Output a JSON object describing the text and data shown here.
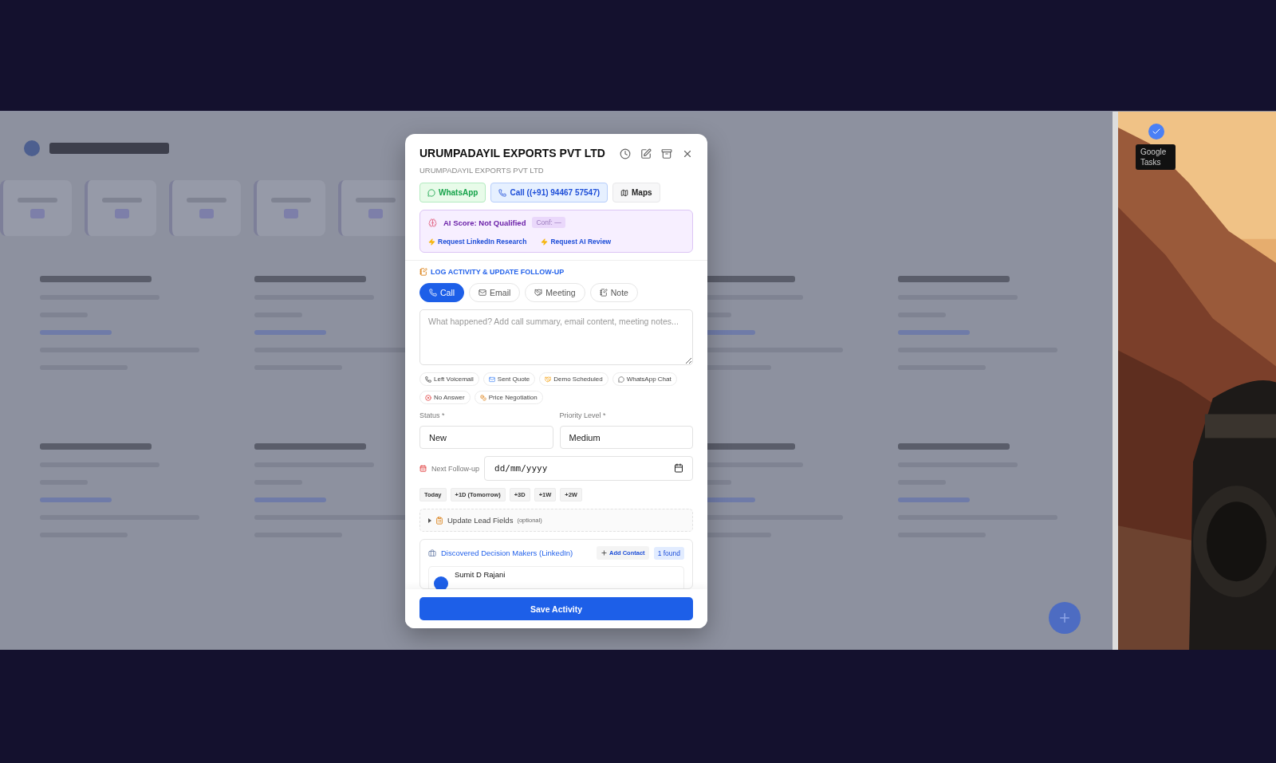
{
  "modal": {
    "title": "URUMPADAYIL EXPORTS PVT LTD",
    "subtitle": "URUMPADAYIL EXPORTS PVT LTD",
    "actions": [
      {
        "kind": "whatsapp",
        "label": "WhatsApp"
      },
      {
        "kind": "call",
        "label": "Call ((+91) 94467 57547)"
      },
      {
        "kind": "maps",
        "label": "Maps"
      }
    ],
    "ai": {
      "score": "AI Score: Not Qualified",
      "confidence": "Conf: —",
      "links": [
        "Request LinkedIn Research",
        "Request AI Review"
      ]
    },
    "section_title": "LOG ACTIVITY & UPDATE FOLLOW-UP",
    "tabs": [
      {
        "kind": "call",
        "label": "Call",
        "selected": true
      },
      {
        "kind": "email",
        "label": "Email",
        "selected": false
      },
      {
        "kind": "meeting",
        "label": "Meeting",
        "selected": false
      },
      {
        "kind": "note",
        "label": "Note",
        "selected": false
      }
    ],
    "notes": {
      "placeholder": "What happened? Add call summary, email content, meeting notes..."
    },
    "quick_tags": [
      {
        "kind": "phone",
        "label": "Left Voicemail"
      },
      {
        "kind": "mail",
        "label": "Sent Quote"
      },
      {
        "kind": "handshake",
        "label": "Demo Scheduled"
      },
      {
        "kind": "chat",
        "label": "WhatsApp Chat"
      },
      {
        "kind": "cross",
        "label": "No Answer"
      },
      {
        "kind": "money",
        "label": "Price Negotiation"
      }
    ],
    "status": {
      "label": "Status *",
      "value": "New"
    },
    "priority": {
      "label": "Priority Level *",
      "value": "Medium"
    },
    "follow_up": {
      "label": "Next Follow-up",
      "placeholder": "dd/mm/yyyy",
      "shortcuts": [
        "Today",
        "+1D (Tomorrow)",
        "+3D",
        "+1W",
        "+2W"
      ]
    },
    "lead_fields": {
      "label": "Update Lead Fields",
      "hint": "(optional)",
      "expanded": false
    },
    "decision_makers": {
      "title": "Discovered Decision Makers (LinkedIn)",
      "add": "Add Contact",
      "count": "1 found",
      "contacts": [
        {
          "name": "Sumit D Rajani"
        }
      ]
    },
    "save": "Save Activity"
  },
  "desktop": {
    "tooltip": "Google Tasks"
  }
}
